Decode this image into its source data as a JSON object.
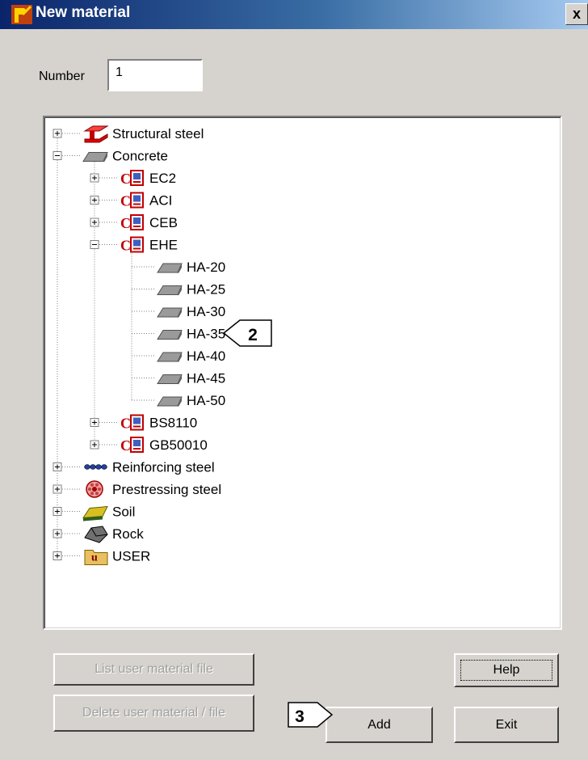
{
  "window": {
    "title": "New material",
    "close_glyph": "x"
  },
  "number": {
    "label": "Number",
    "value": "1"
  },
  "tree": {
    "items": [
      {
        "label": "Structural steel",
        "icon": "structural-steel-icon",
        "level": 0,
        "toggle": "plus"
      },
      {
        "label": "Concrete",
        "icon": "concrete-icon",
        "level": 0,
        "toggle": "minus"
      },
      {
        "label": "EC2",
        "icon": "code-book-icon",
        "level": 1,
        "toggle": "plus"
      },
      {
        "label": "ACI",
        "icon": "code-book-icon",
        "level": 1,
        "toggle": "plus"
      },
      {
        "label": "CEB",
        "icon": "code-book-icon",
        "level": 1,
        "toggle": "plus"
      },
      {
        "label": "EHE",
        "icon": "code-book-icon",
        "level": 1,
        "toggle": "minus"
      },
      {
        "label": "HA-20",
        "icon": "concrete-icon",
        "level": 2,
        "toggle": "none"
      },
      {
        "label": "HA-25",
        "icon": "concrete-icon",
        "level": 2,
        "toggle": "none"
      },
      {
        "label": "HA-30",
        "icon": "concrete-icon",
        "level": 2,
        "toggle": "none"
      },
      {
        "label": "HA-35",
        "icon": "concrete-icon",
        "level": 2,
        "toggle": "none"
      },
      {
        "label": "HA-40",
        "icon": "concrete-icon",
        "level": 2,
        "toggle": "none"
      },
      {
        "label": "HA-45",
        "icon": "concrete-icon",
        "level": 2,
        "toggle": "none"
      },
      {
        "label": "HA-50",
        "icon": "concrete-icon",
        "level": 2,
        "toggle": "none"
      },
      {
        "label": "BS8110",
        "icon": "code-book-icon",
        "level": 1,
        "toggle": "plus"
      },
      {
        "label": "GB50010",
        "icon": "code-book-icon",
        "level": 1,
        "toggle": "plus"
      },
      {
        "label": "Reinforcing steel",
        "icon": "reinforcing-steel-icon",
        "level": 0,
        "toggle": "plus"
      },
      {
        "label": "Prestressing steel",
        "icon": "prestressing-steel-icon",
        "level": 0,
        "toggle": "plus"
      },
      {
        "label": "Soil",
        "icon": "soil-icon",
        "level": 0,
        "toggle": "plus"
      },
      {
        "label": "Rock",
        "icon": "rock-icon",
        "level": 0,
        "toggle": "plus"
      },
      {
        "label": "USER",
        "icon": "user-folder-icon",
        "level": 0,
        "toggle": "plus"
      }
    ]
  },
  "buttons": {
    "list_user_material_file": "List user material file",
    "delete_user_material_file": "Delete user material / file",
    "help": "Help",
    "add": "Add",
    "exit": "Exit"
  },
  "callouts": {
    "tree_item": "2",
    "add_button": "3"
  },
  "colors": {
    "titlebar_start": "#0a246a",
    "titlebar_end": "#a6caf0",
    "dialog_face": "#d6d3ce",
    "code_icon_red": "#c00000"
  }
}
